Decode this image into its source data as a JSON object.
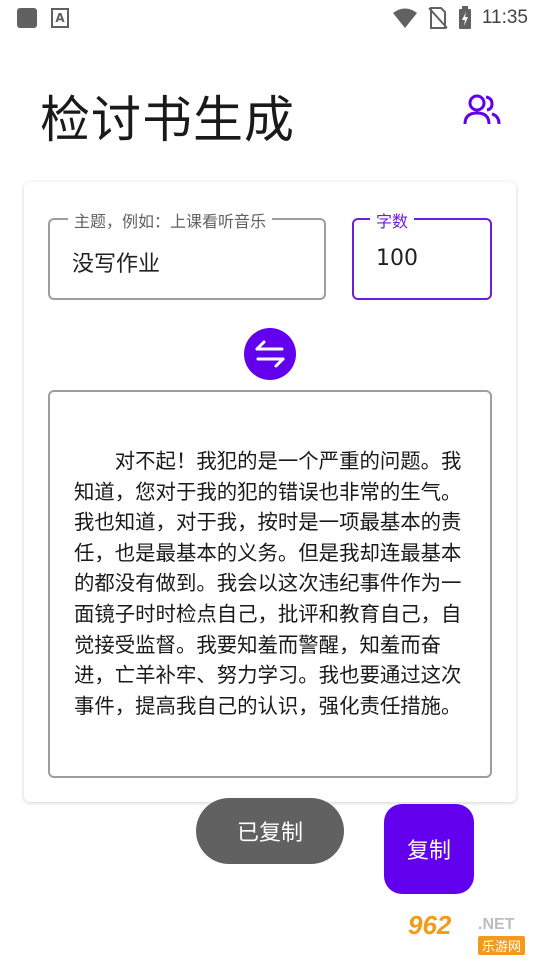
{
  "status_bar": {
    "time": "11:35",
    "notif_icon_label": "A"
  },
  "app": {
    "title": "检讨书生成"
  },
  "form": {
    "topic_label": "主题，例如：上课看听音乐",
    "topic_value": "没写作业",
    "count_label": "字数",
    "count_value": "100"
  },
  "output": {
    "text": "　　对不起！我犯的是一个严重的问题。我知道，您对于我的犯的错误也非常的生气。我也知道，对于我，按时是一项最基本的责任，也是最基本的义务。但是我却连最基本的都没有做到。我会以这次违纪事件作为一面镜子时时检点自己，批评和教育自己，自觉接受监督。我要知羞而警醒，知羞而奋进，亡羊补牢、努力学习。我也要通过这次事件，提高我自己的认识，强化责任措施。"
  },
  "toast": {
    "text": "已复制"
  },
  "buttons": {
    "copy_label": "复制"
  },
  "watermark": {
    "number": "962",
    "domain": ".NET",
    "site": "乐游网"
  },
  "colors": {
    "accent": "#6200ee",
    "toast_bg": "#616161",
    "watermark": "#f29b1a"
  }
}
